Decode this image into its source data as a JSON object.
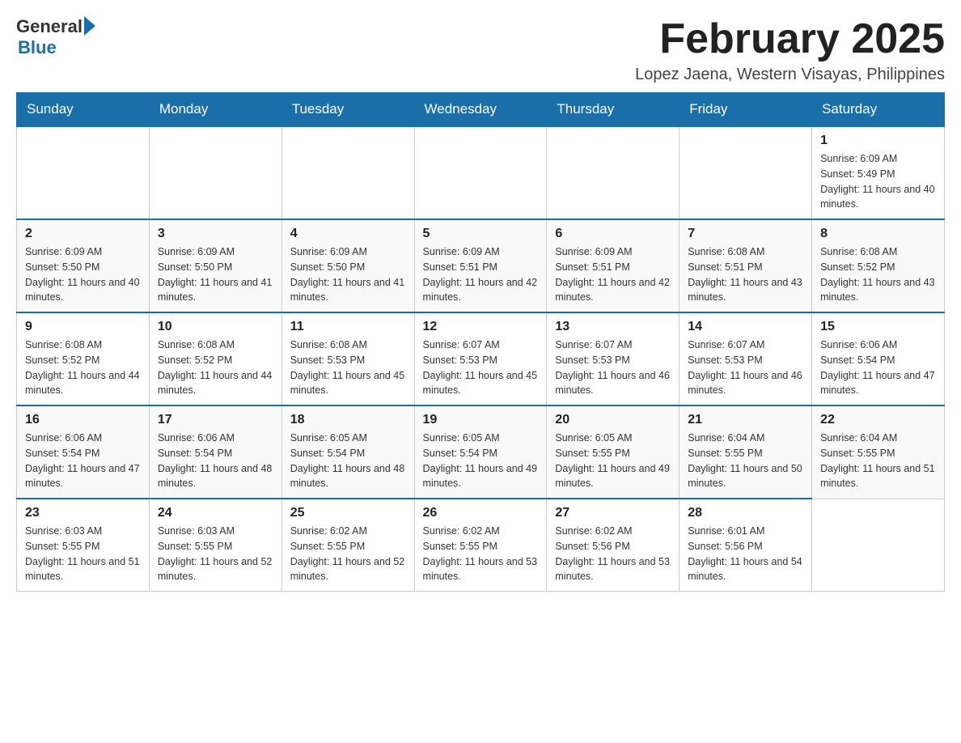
{
  "header": {
    "logo_general": "General",
    "logo_blue": "Blue",
    "month_title": "February 2025",
    "location": "Lopez Jaena, Western Visayas, Philippines"
  },
  "weekdays": [
    "Sunday",
    "Monday",
    "Tuesday",
    "Wednesday",
    "Thursday",
    "Friday",
    "Saturday"
  ],
  "weeks": [
    [
      {
        "day": "",
        "info": ""
      },
      {
        "day": "",
        "info": ""
      },
      {
        "day": "",
        "info": ""
      },
      {
        "day": "",
        "info": ""
      },
      {
        "day": "",
        "info": ""
      },
      {
        "day": "",
        "info": ""
      },
      {
        "day": "1",
        "info": "Sunrise: 6:09 AM\nSunset: 5:49 PM\nDaylight: 11 hours and 40 minutes."
      }
    ],
    [
      {
        "day": "2",
        "info": "Sunrise: 6:09 AM\nSunset: 5:50 PM\nDaylight: 11 hours and 40 minutes."
      },
      {
        "day": "3",
        "info": "Sunrise: 6:09 AM\nSunset: 5:50 PM\nDaylight: 11 hours and 41 minutes."
      },
      {
        "day": "4",
        "info": "Sunrise: 6:09 AM\nSunset: 5:50 PM\nDaylight: 11 hours and 41 minutes."
      },
      {
        "day": "5",
        "info": "Sunrise: 6:09 AM\nSunset: 5:51 PM\nDaylight: 11 hours and 42 minutes."
      },
      {
        "day": "6",
        "info": "Sunrise: 6:09 AM\nSunset: 5:51 PM\nDaylight: 11 hours and 42 minutes."
      },
      {
        "day": "7",
        "info": "Sunrise: 6:08 AM\nSunset: 5:51 PM\nDaylight: 11 hours and 43 minutes."
      },
      {
        "day": "8",
        "info": "Sunrise: 6:08 AM\nSunset: 5:52 PM\nDaylight: 11 hours and 43 minutes."
      }
    ],
    [
      {
        "day": "9",
        "info": "Sunrise: 6:08 AM\nSunset: 5:52 PM\nDaylight: 11 hours and 44 minutes."
      },
      {
        "day": "10",
        "info": "Sunrise: 6:08 AM\nSunset: 5:52 PM\nDaylight: 11 hours and 44 minutes."
      },
      {
        "day": "11",
        "info": "Sunrise: 6:08 AM\nSunset: 5:53 PM\nDaylight: 11 hours and 45 minutes."
      },
      {
        "day": "12",
        "info": "Sunrise: 6:07 AM\nSunset: 5:53 PM\nDaylight: 11 hours and 45 minutes."
      },
      {
        "day": "13",
        "info": "Sunrise: 6:07 AM\nSunset: 5:53 PM\nDaylight: 11 hours and 46 minutes."
      },
      {
        "day": "14",
        "info": "Sunrise: 6:07 AM\nSunset: 5:53 PM\nDaylight: 11 hours and 46 minutes."
      },
      {
        "day": "15",
        "info": "Sunrise: 6:06 AM\nSunset: 5:54 PM\nDaylight: 11 hours and 47 minutes."
      }
    ],
    [
      {
        "day": "16",
        "info": "Sunrise: 6:06 AM\nSunset: 5:54 PM\nDaylight: 11 hours and 47 minutes."
      },
      {
        "day": "17",
        "info": "Sunrise: 6:06 AM\nSunset: 5:54 PM\nDaylight: 11 hours and 48 minutes."
      },
      {
        "day": "18",
        "info": "Sunrise: 6:05 AM\nSunset: 5:54 PM\nDaylight: 11 hours and 48 minutes."
      },
      {
        "day": "19",
        "info": "Sunrise: 6:05 AM\nSunset: 5:54 PM\nDaylight: 11 hours and 49 minutes."
      },
      {
        "day": "20",
        "info": "Sunrise: 6:05 AM\nSunset: 5:55 PM\nDaylight: 11 hours and 49 minutes."
      },
      {
        "day": "21",
        "info": "Sunrise: 6:04 AM\nSunset: 5:55 PM\nDaylight: 11 hours and 50 minutes."
      },
      {
        "day": "22",
        "info": "Sunrise: 6:04 AM\nSunset: 5:55 PM\nDaylight: 11 hours and 51 minutes."
      }
    ],
    [
      {
        "day": "23",
        "info": "Sunrise: 6:03 AM\nSunset: 5:55 PM\nDaylight: 11 hours and 51 minutes."
      },
      {
        "day": "24",
        "info": "Sunrise: 6:03 AM\nSunset: 5:55 PM\nDaylight: 11 hours and 52 minutes."
      },
      {
        "day": "25",
        "info": "Sunrise: 6:02 AM\nSunset: 5:55 PM\nDaylight: 11 hours and 52 minutes."
      },
      {
        "day": "26",
        "info": "Sunrise: 6:02 AM\nSunset: 5:55 PM\nDaylight: 11 hours and 53 minutes."
      },
      {
        "day": "27",
        "info": "Sunrise: 6:02 AM\nSunset: 5:56 PM\nDaylight: 11 hours and 53 minutes."
      },
      {
        "day": "28",
        "info": "Sunrise: 6:01 AM\nSunset: 5:56 PM\nDaylight: 11 hours and 54 minutes."
      },
      {
        "day": "",
        "info": ""
      }
    ]
  ]
}
